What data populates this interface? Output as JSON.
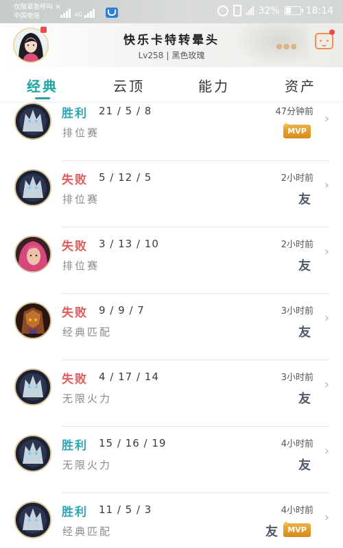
{
  "status_bar": {
    "carrier_line1": "仅限紧急呼叫",
    "carrier_line2": "中国电信",
    "network": "4G",
    "battery": "32%",
    "battery_level": 0.32,
    "time": "18:14",
    "color": "#ffffff"
  },
  "profile": {
    "nickname": "快乐卡特转晕头",
    "level": "Lv258",
    "rank": "黑色玫瑰",
    "avatar_icon": "user-avatar"
  },
  "tabs": [
    {
      "label": "经典",
      "active": true
    },
    {
      "label": "云顶",
      "active": false
    },
    {
      "label": "能力",
      "active": false
    },
    {
      "label": "资产",
      "active": false
    }
  ],
  "labels": {
    "mvp": "MVP",
    "friend": "友"
  },
  "colors": {
    "accent": "#1fa5a0",
    "win": "#2ea6b8",
    "lose": "#e25a5a",
    "mvp": "#e09a27"
  },
  "matches": [
    {
      "result": "胜利",
      "outcome": "win",
      "kda": "21 / 5 / 8",
      "mode": "排位赛",
      "time": "47分钟前",
      "mvp": true,
      "friend": false,
      "hero_icon": "wolf-champion-icon"
    },
    {
      "result": "失败",
      "outcome": "lose",
      "kda": "5 / 12 / 5",
      "mode": "排位赛",
      "time": "2小时前",
      "mvp": false,
      "friend": true,
      "hero_icon": "wolf-champion-icon"
    },
    {
      "result": "失败",
      "outcome": "lose",
      "kda": "3 / 13 / 10",
      "mode": "排位赛",
      "time": "2小时前",
      "mvp": false,
      "friend": true,
      "hero_icon": "red-hair-champion-icon"
    },
    {
      "result": "失败",
      "outcome": "lose",
      "kda": "9 / 9 / 7",
      "mode": "经典匹配",
      "time": "3小时前",
      "mvp": false,
      "friend": true,
      "hero_icon": "armored-champion-icon"
    },
    {
      "result": "失败",
      "outcome": "lose",
      "kda": "4 / 17 / 14",
      "mode": "无限火力",
      "time": "3小时前",
      "mvp": false,
      "friend": true,
      "hero_icon": "wolf-champion-icon"
    },
    {
      "result": "胜利",
      "outcome": "win",
      "kda": "15 / 16 / 19",
      "mode": "无限火力",
      "time": "4小时前",
      "mvp": false,
      "friend": true,
      "hero_icon": "wolf-champion-icon"
    },
    {
      "result": "胜利",
      "outcome": "win",
      "kda": "11 / 5 / 3",
      "mode": "经典匹配",
      "time": "4小时前",
      "mvp": true,
      "friend": true,
      "hero_icon": "wolf-champion-icon"
    }
  ]
}
